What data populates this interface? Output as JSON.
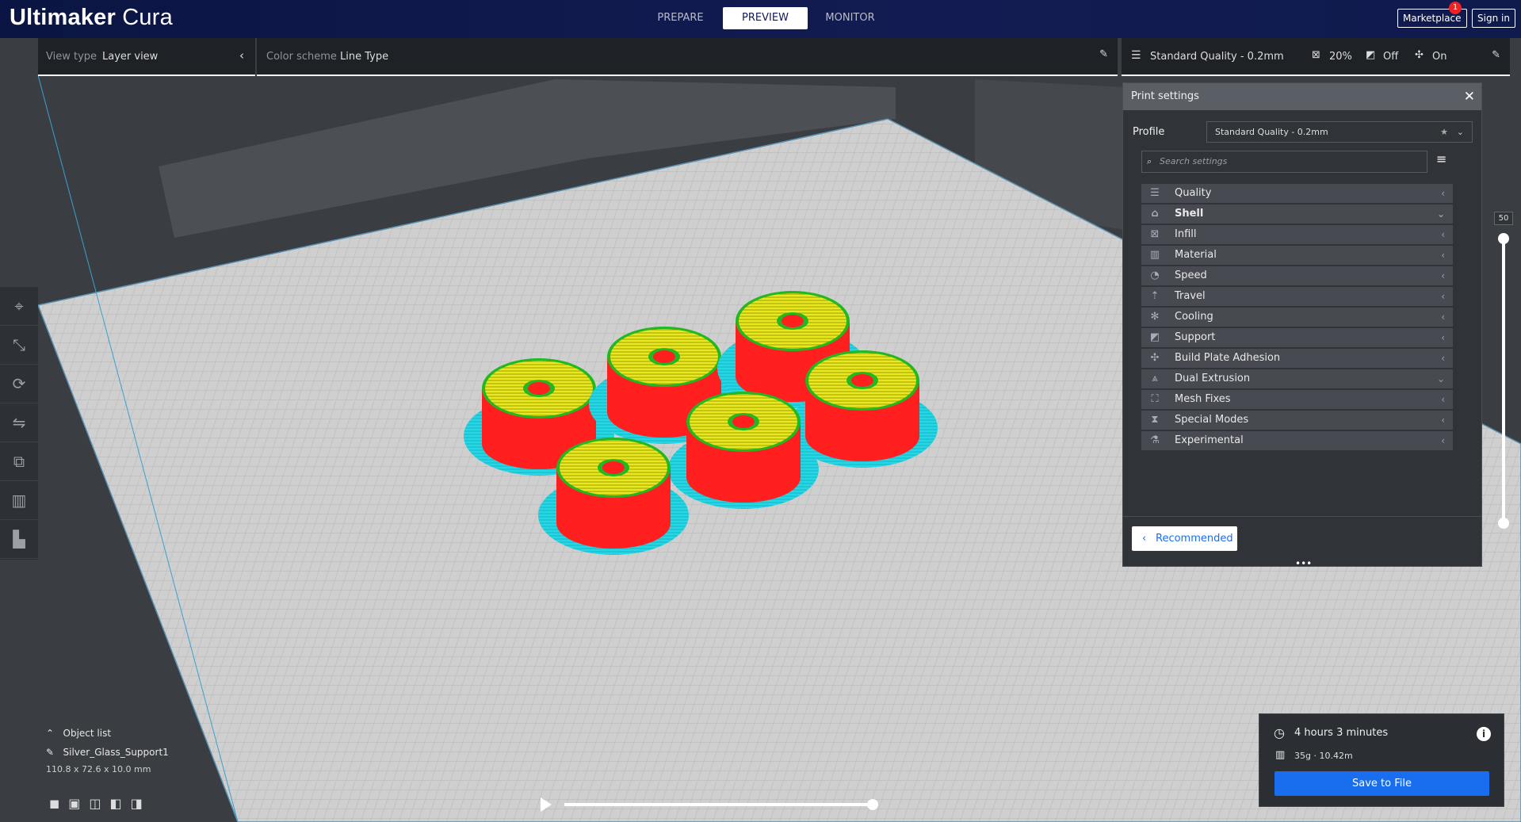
{
  "app": {
    "name_bold": "Ultimaker",
    "name_rest": " Cura"
  },
  "stages": {
    "prepare": "PREPARE",
    "preview": "PREVIEW",
    "monitor": "MONITOR"
  },
  "header": {
    "marketplace": "Marketplace",
    "marketplace_badge": "1",
    "signin": "Sign in"
  },
  "viewbar": {
    "view_type_label": "View type",
    "view_type_value": "Layer view",
    "color_scheme_label": "Color scheme",
    "color_scheme_value": "Line Type"
  },
  "settings_bar": {
    "profile": "Standard Quality - 0.2mm",
    "infill": "20%",
    "support": "Off",
    "adhesion": "On"
  },
  "print_settings": {
    "title": "Print settings",
    "profile_label": "Profile",
    "profile_value": "Standard Quality - 0.2mm",
    "search_placeholder": "Search settings",
    "categories": [
      {
        "label": "Quality",
        "icon": "quality-icon",
        "state": "collapsed"
      },
      {
        "label": "Shell",
        "icon": "shell-icon",
        "state": "expanded"
      },
      {
        "label": "Infill",
        "icon": "infill-icon",
        "state": "collapsed"
      },
      {
        "label": "Material",
        "icon": "material-icon",
        "state": "collapsed"
      },
      {
        "label": "Speed",
        "icon": "speed-icon",
        "state": "collapsed"
      },
      {
        "label": "Travel",
        "icon": "travel-icon",
        "state": "collapsed"
      },
      {
        "label": "Cooling",
        "icon": "cooling-icon",
        "state": "collapsed"
      },
      {
        "label": "Support",
        "icon": "support-icon",
        "state": "collapsed"
      },
      {
        "label": "Build Plate Adhesion",
        "icon": "adhesion-icon",
        "state": "collapsed"
      },
      {
        "label": "Dual Extrusion",
        "icon": "dual-extrusion-icon",
        "state": "expanded"
      },
      {
        "label": "Mesh Fixes",
        "icon": "mesh-fixes-icon",
        "state": "collapsed"
      },
      {
        "label": "Special Modes",
        "icon": "special-modes-icon",
        "state": "collapsed"
      },
      {
        "label": "Experimental",
        "icon": "experimental-icon",
        "state": "collapsed"
      }
    ],
    "recommended_button": "Recommended"
  },
  "layer_slider": {
    "value": "50"
  },
  "object": {
    "list_label": "Object list",
    "name": "Silver_Glass_Support1",
    "dimensions": "110.8 x 72.6 x 10.0 mm"
  },
  "print_info": {
    "time": "4 hours 3 minutes",
    "material": "35g · 10.42m",
    "save_button": "Save to File"
  },
  "colors": {
    "brand_dark": "#0a1543",
    "accent_blue": "#196ef0",
    "wall_red": "#ff1f1f",
    "infill_yellow": "#e8e81a",
    "skirt_cyan": "#23d7e6",
    "inner_green": "#22b822"
  }
}
